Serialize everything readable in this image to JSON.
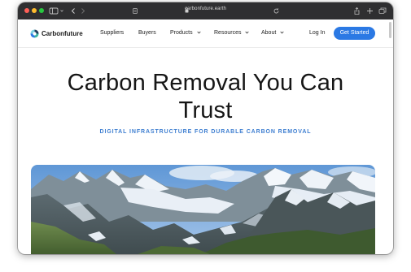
{
  "browser": {
    "url": "carbonfuture.earth",
    "icons": {
      "close": "close-dot",
      "minimize": "minimize-dot",
      "zoom": "zoom-dot",
      "sidebar": "sidebar-icon",
      "back": "chevron-left-icon",
      "forward": "chevron-right-icon",
      "privacy": "privacy-icon",
      "lock": "lock-icon",
      "reload": "reload-icon",
      "share": "share-icon",
      "new_tab": "plus-icon",
      "tabs": "tabs-icon"
    }
  },
  "nav": {
    "brand": "Carbonfuture",
    "items": [
      {
        "label": "Suppliers",
        "dropdown": false
      },
      {
        "label": "Buyers",
        "dropdown": false
      },
      {
        "label": "Products",
        "dropdown": true
      },
      {
        "label": "Resources",
        "dropdown": true
      },
      {
        "label": "About",
        "dropdown": true
      }
    ],
    "login": "Log In",
    "cta": "Get Started"
  },
  "hero": {
    "title_line1": "Carbon Removal You Can",
    "title_line2": "Trust",
    "subtitle": "DIGITAL INFRASTRUCTURE FOR DURABLE CARBON REMOVAL",
    "image": "mountain-landscape"
  },
  "colors": {
    "accent": "#2b79e4",
    "subtitle": "#3f7fd1",
    "chrome": "#2f2f31"
  }
}
